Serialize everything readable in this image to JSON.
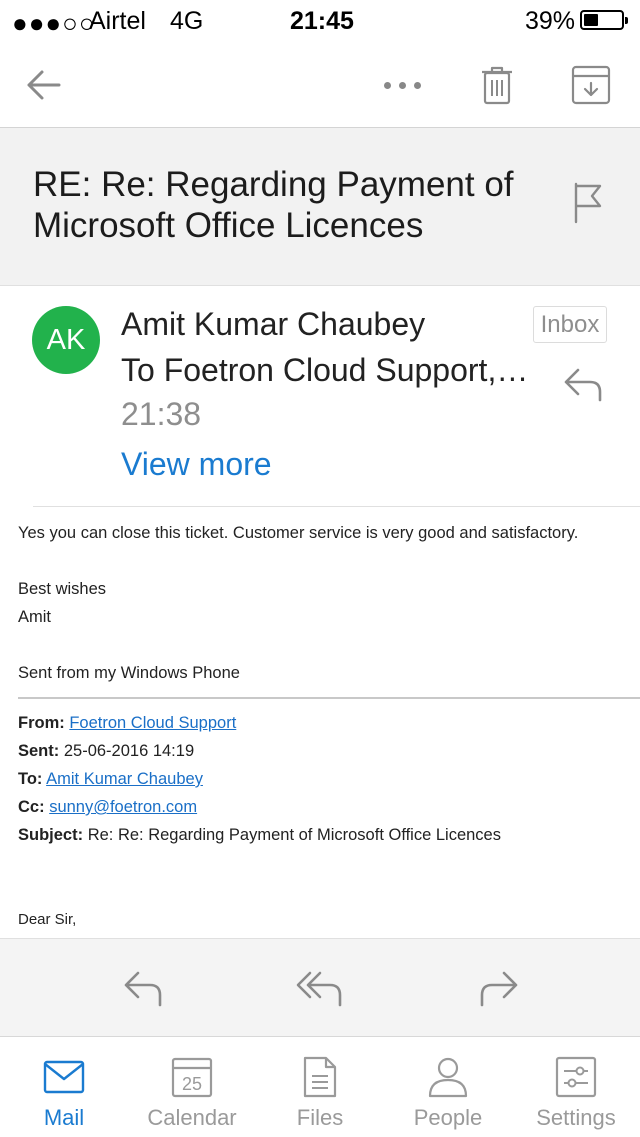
{
  "status_bar": {
    "signal": "●●●○○",
    "carrier": "Airtel",
    "network": "4G",
    "time": "21:45",
    "battery_percent": "39%",
    "battery_level": 0.39
  },
  "toolbar": {
    "back_icon": "arrow-left-icon",
    "more_icon": "more-horizontal-icon",
    "delete_icon": "trash-icon",
    "archive_icon": "archive-box-icon"
  },
  "message": {
    "subject": "RE: Re: Regarding Payment of Microsoft Office Licences",
    "flag_icon": "flag-icon",
    "sender": {
      "initials": "AK",
      "name": "Amit Kumar Chaubey",
      "avatar_color": "#22b24c"
    },
    "to_line": "To Foetron Cloud Support, sunny@foetron.com",
    "time": "21:38",
    "view_more": "View more",
    "folder": "Inbox",
    "body": {
      "line1": "Yes you can close this ticket. Customer service is very good and satisfactory.",
      "line2": "Best wishes",
      "line3": "Amit",
      "line4": "Sent from my Windows Phone"
    },
    "quoted": {
      "from_label": "From:",
      "from_value": "Foetron Cloud Support",
      "sent_label": "Sent:",
      "sent_value": "25-06-2016 14:19",
      "to_label": "To:",
      "to_value": "Amit Kumar Chaubey",
      "cc_label": "Cc:",
      "cc_value": "sunny@foetron.com",
      "subject_label": "Subject:",
      "subject_value": "Re: Re: Regarding Payment of Microsoft Office Licences",
      "greeting": "Dear Sir,"
    }
  },
  "actions": {
    "reply_icon": "reply-icon",
    "reply_all_icon": "reply-all-icon",
    "forward_icon": "forward-icon"
  },
  "tabs": [
    {
      "label": "Mail",
      "icon": "mail-icon",
      "active": true
    },
    {
      "label": "Calendar",
      "icon": "calendar-icon",
      "badge": "25"
    },
    {
      "label": "Files",
      "icon": "file-icon"
    },
    {
      "label": "People",
      "icon": "person-icon"
    },
    {
      "label": "Settings",
      "icon": "sliders-icon"
    }
  ],
  "colors": {
    "accent": "#1a7bd0",
    "link": "#1a6fc7",
    "avatar": "#22b24c",
    "icon_gray": "#8a8a8a"
  }
}
